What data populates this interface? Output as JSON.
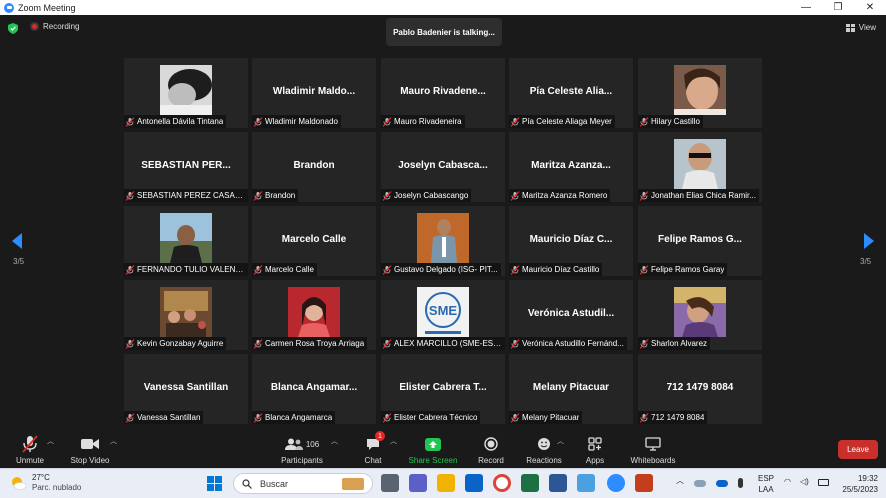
{
  "window": {
    "title": "Zoom Meeting",
    "minimize": "—",
    "maximize": "❐",
    "close": "✕"
  },
  "topbar": {
    "recording": "Recording",
    "talking": "Pablo Badenier is talking...",
    "view": "View"
  },
  "pagination": {
    "left": "3/5",
    "right": "3/5"
  },
  "tiles": [
    {
      "big": "",
      "label": "Antonella Dávila Tintana",
      "photo": "photo-bw-woman"
    },
    {
      "big": "Wladimir  Maldo...",
      "label": "Wladimir Maldonado"
    },
    {
      "big": "Mauro  Rivadene...",
      "label": "Mauro Rivadeneira"
    },
    {
      "big": "Pía Celeste  Alia...",
      "label": "Pía Celeste Aliaga Meyer"
    },
    {
      "big": "",
      "label": "Hilary Castillo",
      "photo": "photo-woman-selfie"
    },
    {
      "big": "SEBASTIAN  PER...",
      "label": "SEBASTIAN PEREZ CASAN..."
    },
    {
      "big": "Brandon",
      "label": "Brandon"
    },
    {
      "big": "Joselyn  Cabasca...",
      "label": "Joselyn Cabascango"
    },
    {
      "big": "Maritza  Azanza...",
      "label": "Maritza Azanza Romero"
    },
    {
      "big": "",
      "label": "Jonathan Elias Chica Ramir...",
      "photo": "photo-man-sunglasses"
    },
    {
      "big": "",
      "label": "FERNANDO TULIO VALENC...",
      "photo": "photo-man-outdoors"
    },
    {
      "big": "Marcelo Calle",
      "label": "Marcelo Calle"
    },
    {
      "big": "",
      "label": "Gustavo  Delgado (ISG- PIT...",
      "photo": "photo-man-suit"
    },
    {
      "big": "Mauricio  Díaz  C...",
      "label": "Mauricio Díaz Castillo"
    },
    {
      "big": "Felipe  Ramos  G...",
      "label": "Felipe Ramos Garay"
    },
    {
      "big": "",
      "label": "Kevin Gonzabay Aguirre",
      "photo": "photo-group-room"
    },
    {
      "big": "",
      "label": "Carmen Rosa Troya Arriaga",
      "photo": "photo-woman-red"
    },
    {
      "big": "",
      "label": "ALEX MARCILLO (SME-ESP...",
      "photo": "photo-sme-logo"
    },
    {
      "big": "Verónica  Astudil...",
      "label": "Verónica Astudillo Fernánd..."
    },
    {
      "big": "",
      "label": "Sharlon Alvarez",
      "photo": "photo-woman-purple"
    },
    {
      "big": "Vanessa Santillan",
      "label": "Vanessa Santillan"
    },
    {
      "big": "Blanca  Angamar...",
      "label": "Blanca Angamarca"
    },
    {
      "big": "Elister Cabrera  T...",
      "label": "Elister Cabrera Técnico"
    },
    {
      "big": "Melany Pitacuar",
      "label": "Melany Pitacuar"
    },
    {
      "big": "712 1479 8084",
      "label": "712 1479 8084"
    }
  ],
  "sme_logo_text": "SME",
  "toolbar": {
    "unmute": "Unmute",
    "stop_video": "Stop Video",
    "participants": "Participants",
    "participants_count": "106",
    "chat": "Chat",
    "chat_badge": "1",
    "share_screen": "Share Screen",
    "record": "Record",
    "reactions": "Reactions",
    "apps": "Apps",
    "whiteboards": "Whiteboards",
    "leave": "Leave"
  },
  "colors": {
    "accent_blue": "#2d8cff",
    "share_green": "#23c552",
    "leave_red": "#c9302c"
  },
  "taskbar": {
    "temp": "27°C",
    "weather": "Parc. nublado",
    "search_placeholder": "Buscar",
    "lang1": "ESP",
    "lang2": "LAA",
    "time": "19:32",
    "date": "25/5/2023"
  }
}
